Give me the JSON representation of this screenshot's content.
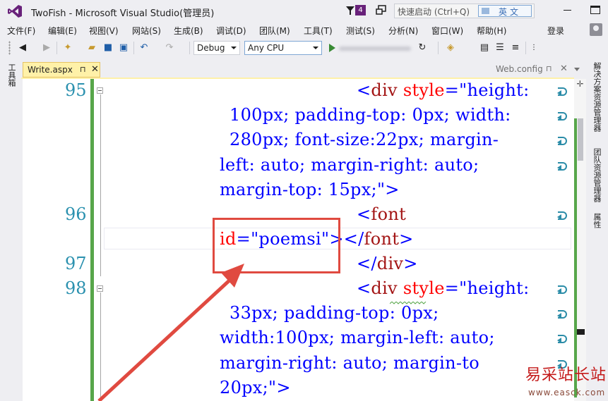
{
  "titlebar": {
    "app_title": "TwoFish - Microsoft Visual Studio(管理员)",
    "notification_count": "4",
    "quick_launch_placeholder": "快速启动 (Ctrl+Q)",
    "ime_label": "英文"
  },
  "menu": {
    "items": [
      "文件(F)",
      "编辑(E)",
      "视图(V)",
      "网站(S)",
      "生成(B)",
      "调试(D)",
      "团队(M)",
      "工具(T)",
      "测试(S)",
      "分析(N)",
      "窗口(W)",
      "帮助(H)"
    ],
    "login": "登录"
  },
  "toolbar": {
    "configuration": "Debug",
    "platform": "Any CPU"
  },
  "left_panel": {
    "toolbox_label": "工具箱"
  },
  "right_panel": {
    "solution_explorer": "解决方案资源管理器",
    "team_explorer": "团队资源管理器",
    "properties": "属性"
  },
  "tabs": {
    "active": "Write.aspx",
    "other": "Web.config",
    "pin_glyph": "⊓",
    "close_glyph": "✕"
  },
  "editor": {
    "line_numbers": [
      "95",
      "96",
      "97",
      "98"
    ],
    "line95_a_bracket": "<",
    "line95_a_tag": "div",
    "line95_a_attr": " style",
    "line95_a_eq": "=",
    "line95_a_val": "\"height:",
    "line95_b_val": "100px; padding-top: 0px; width:",
    "line95_c_val": "280px; font-size:22px; margin-",
    "line95_d_val": "left: auto; margin-right: auto;",
    "line95_e_val": "margin-top: 15px;\"",
    "line95_e_close": ">",
    "line96_a_bracket": "<",
    "line96_a_tag": "font",
    "line96_b_attr": "id",
    "line96_b_eq": "=",
    "line96_b_val": "\"poemsi\"",
    "line96_b_rest1": "></",
    "line96_b_tag": "font",
    "line96_b_rest2": ">",
    "line97_open": "</",
    "line97_tag": "div",
    "line97_close": ">",
    "line98_a_bracket": "<",
    "line98_a_tag": "div",
    "line98_a_attr": " style",
    "line98_a_eq": "=",
    "line98_a_val": "\"height:",
    "line98_b_val": "33px; padding-top: 0px;",
    "line98_c_val": "width:100px; margin-left: auto;",
    "line98_d_val": "margin-right: auto; margin-to",
    "line98_e_val": "20px;\"",
    "line98_e_close": ">"
  },
  "watermark": {
    "brand": "易采站长站",
    "url": "www.easck.com"
  },
  "colors": {
    "accent": "#68217a",
    "tab_active": "#fff1a8",
    "change_bar": "#57a64a",
    "annotation": "#e04a40"
  }
}
